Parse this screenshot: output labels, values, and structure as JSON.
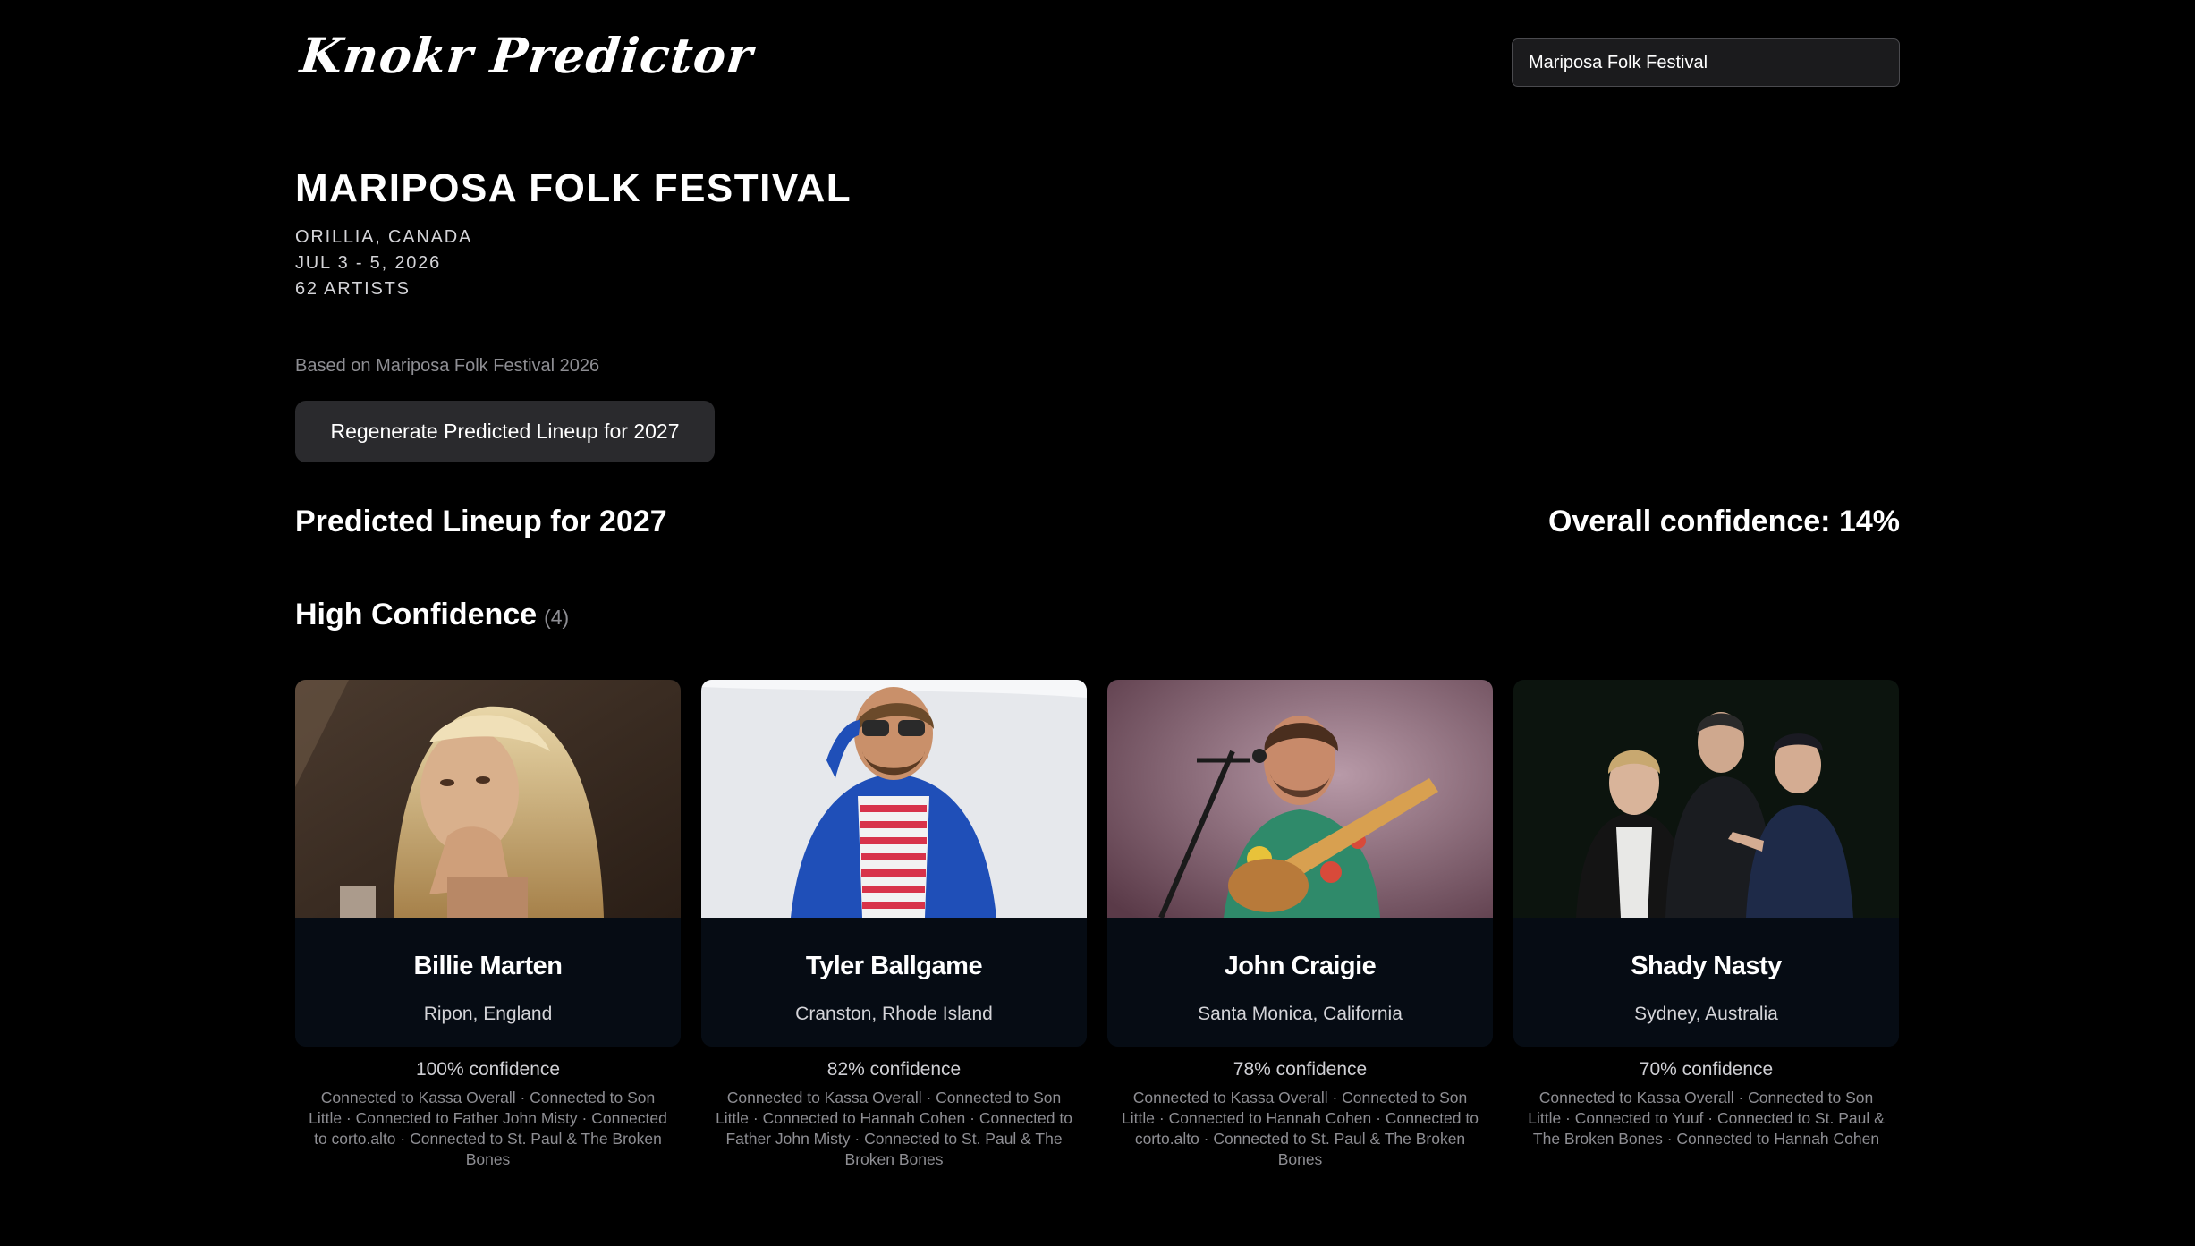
{
  "app": {
    "logo": "Knokr Predictor"
  },
  "search": {
    "value": "Mariposa Folk Festival"
  },
  "festival": {
    "name": "MARIPOSA FOLK FESTIVAL",
    "location": "ORILLIA, CANADA",
    "dates": "JUL 3 - 5, 2026",
    "artists": "62 ARTISTS",
    "based_on": "Based on Mariposa Folk Festival 2026"
  },
  "actions": {
    "regenerate_label": "Regenerate Predicted Lineup for 2027"
  },
  "lineup": {
    "title": "Predicted Lineup for 2027",
    "overall_confidence": "Overall confidence: 14%"
  },
  "section": {
    "title": "High Confidence",
    "count": "(4)"
  },
  "cards": [
    {
      "name": "Billie Marten",
      "location": "Ripon, England",
      "confidence": "100% confidence",
      "connections": "Connected to Kassa Overall · Connected to Son Little · Connected to Father John Misty · Connected to corto.alto · Connected to St. Paul & The Broken Bones"
    },
    {
      "name": "Tyler Ballgame",
      "location": "Cranston, Rhode Island",
      "confidence": "82% confidence",
      "connections": "Connected to Kassa Overall · Connected to Son Little · Connected to Hannah Cohen · Connected to Father John Misty · Connected to St. Paul & The Broken Bones"
    },
    {
      "name": "John Craigie",
      "location": "Santa Monica, California",
      "confidence": "78% confidence",
      "connections": "Connected to Kassa Overall · Connected to Son Little · Connected to Hannah Cohen · Connected to corto.alto · Connected to St. Paul & The Broken Bones"
    },
    {
      "name": "Shady Nasty",
      "location": "Sydney, Australia",
      "confidence": "70% confidence",
      "connections": "Connected to Kassa Overall · Connected to Son Little · Connected to Yuuf · Connected to St. Paul & The Broken Bones · Connected to Hannah Cohen"
    }
  ]
}
